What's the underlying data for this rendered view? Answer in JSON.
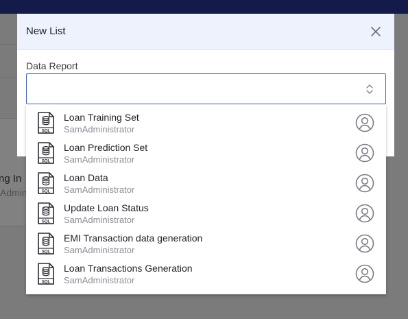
{
  "background": {
    "partial_title": "ng In",
    "partial_subtitle": "Admin"
  },
  "modal": {
    "title": "New List",
    "close_icon": "close-icon",
    "field_label": "Data Report",
    "select_value": "",
    "select_icon": "chevron-up-down-icon"
  },
  "dropdown": {
    "options": [
      {
        "title": "Loan Training Set",
        "owner": "SamAdministrator",
        "icon": "sql-file-icon"
      },
      {
        "title": "Loan Prediction Set",
        "owner": "SamAdministrator",
        "icon": "sql-file-icon"
      },
      {
        "title": "Loan Data",
        "owner": "SamAdministrator",
        "icon": "sql-file-icon"
      },
      {
        "title": "Update Loan Status",
        "owner": "SamAdministrator",
        "icon": "sql-file-icon"
      },
      {
        "title": "EMI Transaction data generation",
        "owner": "SamAdministrator",
        "icon": "sql-file-icon"
      },
      {
        "title": "Loan Transactions Generation",
        "owner": "SamAdministrator",
        "icon": "sql-file-icon"
      }
    ]
  },
  "colors": {
    "topbar": "#141a4a",
    "header_bg": "#edf2fd",
    "accent": "#4462b5"
  }
}
